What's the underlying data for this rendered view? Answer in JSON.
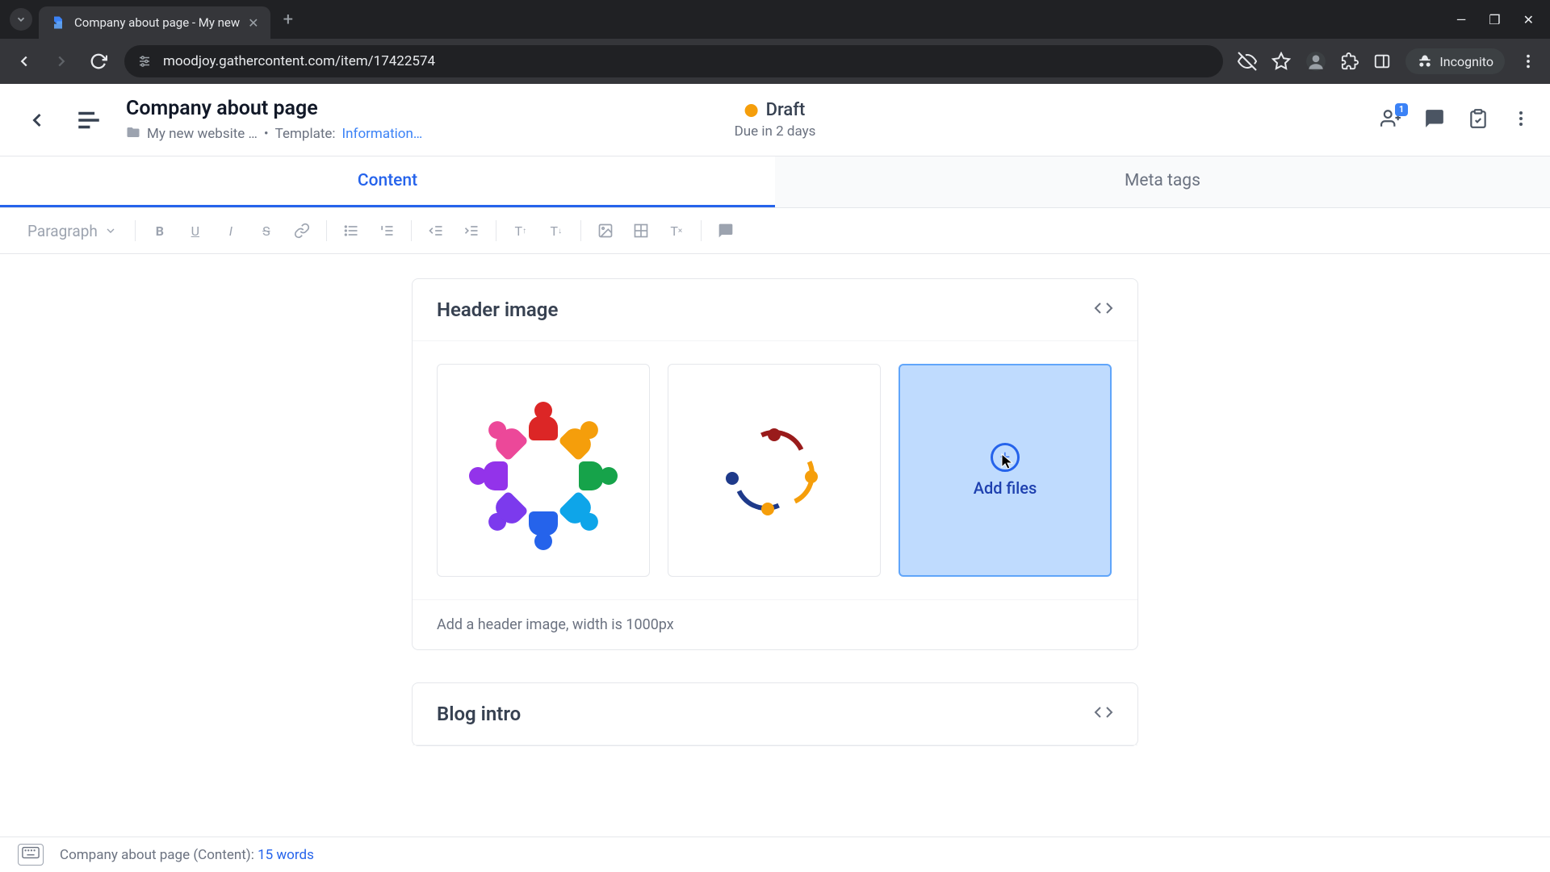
{
  "browser": {
    "tab_title": "Company about page - My new",
    "url": "moodjoy.gathercontent.com/item/17422574",
    "incognito_label": "Incognito"
  },
  "header": {
    "title": "Company about page",
    "breadcrumb_project": "My new website …",
    "template_label": "Template:",
    "template_value": "Information…",
    "status": "Draft",
    "due": "Due in 2 days",
    "people_badge": "1"
  },
  "tabs": {
    "content": "Content",
    "meta": "Meta tags"
  },
  "toolbar": {
    "style": "Paragraph"
  },
  "card_header": {
    "title": "Header image",
    "add_files": "Add files",
    "hint": "Add a header image, width is 1000px"
  },
  "card_blog": {
    "title": "Blog intro"
  },
  "footer": {
    "doc_label": "Company about page (Content): ",
    "word_count": "15 words"
  }
}
